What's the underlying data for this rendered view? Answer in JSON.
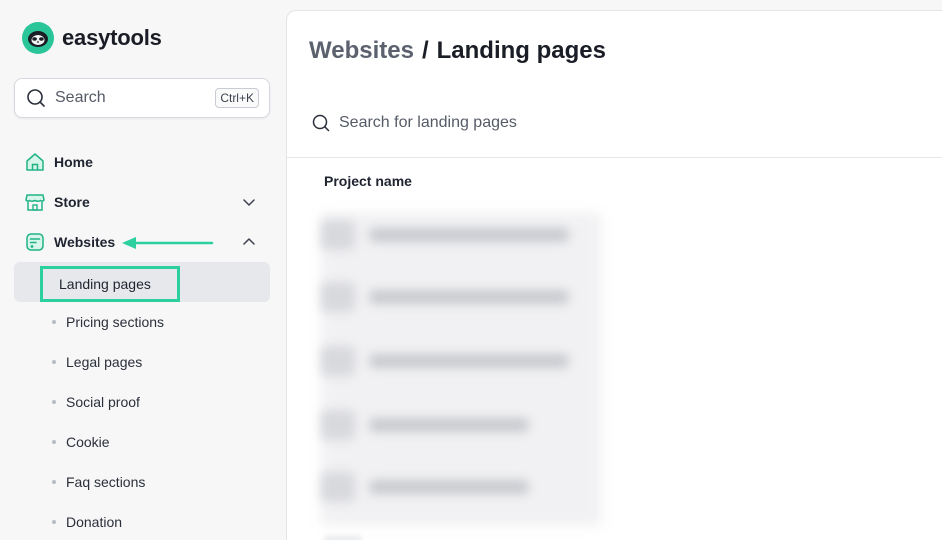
{
  "brand": {
    "name": "easytools",
    "color": "#2bc59a"
  },
  "sidebar": {
    "search": {
      "placeholder": "Search",
      "shortcut": "Ctrl+K"
    },
    "nav": [
      {
        "label": "Home",
        "icon": "home-icon"
      },
      {
        "label": "Store",
        "icon": "store-icon",
        "expanded": false
      },
      {
        "label": "Websites",
        "icon": "websites-icon",
        "expanded": true
      }
    ],
    "websites_children": [
      {
        "label": "Landing pages",
        "active": true
      },
      {
        "label": "Pricing sections"
      },
      {
        "label": "Legal pages"
      },
      {
        "label": "Social proof"
      },
      {
        "label": "Cookie"
      },
      {
        "label": "Faq sections"
      },
      {
        "label": "Donation"
      }
    ]
  },
  "main": {
    "breadcrumb": {
      "parent": "Websites",
      "separator": "/",
      "current": "Landing pages"
    },
    "search_placeholder": "Search for landing pages",
    "table": {
      "columns": [
        "Project name"
      ]
    }
  },
  "annotation": {
    "highlight_color": "#2ccf9e"
  }
}
